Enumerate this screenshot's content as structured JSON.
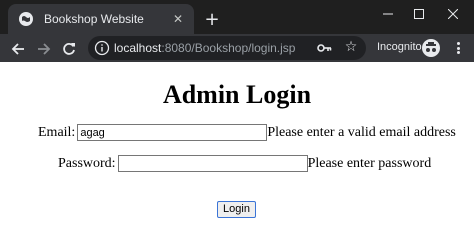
{
  "browser": {
    "tab_title": "Bookshop Website",
    "new_tab_label": "+",
    "url_host": "localhost",
    "url_rest": ":8080/Bookshop/login.jsp",
    "incognito_label": "Incognito"
  },
  "page": {
    "title": "Admin Login",
    "email_label": "Email:",
    "email_value": "agag",
    "email_error": "Please enter a valid email address",
    "password_label": "Password:",
    "password_value": "",
    "password_error": "Please enter password",
    "login_button": "Login"
  },
  "colors": {
    "tabstrip_bg": "#1f1f1f",
    "toolbar_bg": "#35363a",
    "omnibox_bg": "#202124",
    "button_focus_border": "#3b74d6"
  }
}
